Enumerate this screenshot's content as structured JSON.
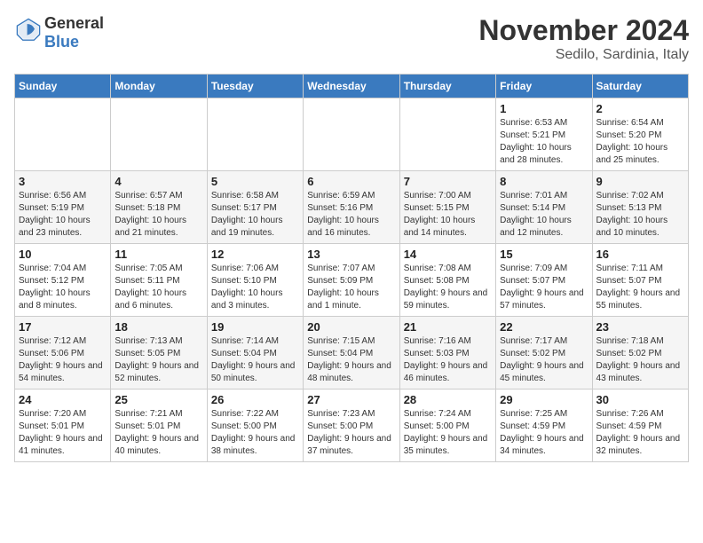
{
  "logo": {
    "line1": "General",
    "line2": "Blue"
  },
  "title": "November 2024",
  "location": "Sedilo, Sardinia, Italy",
  "weekdays": [
    "Sunday",
    "Monday",
    "Tuesday",
    "Wednesday",
    "Thursday",
    "Friday",
    "Saturday"
  ],
  "weeks": [
    [
      {
        "day": "",
        "info": ""
      },
      {
        "day": "",
        "info": ""
      },
      {
        "day": "",
        "info": ""
      },
      {
        "day": "",
        "info": ""
      },
      {
        "day": "",
        "info": ""
      },
      {
        "day": "1",
        "info": "Sunrise: 6:53 AM\nSunset: 5:21 PM\nDaylight: 10 hours and 28 minutes."
      },
      {
        "day": "2",
        "info": "Sunrise: 6:54 AM\nSunset: 5:20 PM\nDaylight: 10 hours and 25 minutes."
      }
    ],
    [
      {
        "day": "3",
        "info": "Sunrise: 6:56 AM\nSunset: 5:19 PM\nDaylight: 10 hours and 23 minutes."
      },
      {
        "day": "4",
        "info": "Sunrise: 6:57 AM\nSunset: 5:18 PM\nDaylight: 10 hours and 21 minutes."
      },
      {
        "day": "5",
        "info": "Sunrise: 6:58 AM\nSunset: 5:17 PM\nDaylight: 10 hours and 19 minutes."
      },
      {
        "day": "6",
        "info": "Sunrise: 6:59 AM\nSunset: 5:16 PM\nDaylight: 10 hours and 16 minutes."
      },
      {
        "day": "7",
        "info": "Sunrise: 7:00 AM\nSunset: 5:15 PM\nDaylight: 10 hours and 14 minutes."
      },
      {
        "day": "8",
        "info": "Sunrise: 7:01 AM\nSunset: 5:14 PM\nDaylight: 10 hours and 12 minutes."
      },
      {
        "day": "9",
        "info": "Sunrise: 7:02 AM\nSunset: 5:13 PM\nDaylight: 10 hours and 10 minutes."
      }
    ],
    [
      {
        "day": "10",
        "info": "Sunrise: 7:04 AM\nSunset: 5:12 PM\nDaylight: 10 hours and 8 minutes."
      },
      {
        "day": "11",
        "info": "Sunrise: 7:05 AM\nSunset: 5:11 PM\nDaylight: 10 hours and 6 minutes."
      },
      {
        "day": "12",
        "info": "Sunrise: 7:06 AM\nSunset: 5:10 PM\nDaylight: 10 hours and 3 minutes."
      },
      {
        "day": "13",
        "info": "Sunrise: 7:07 AM\nSunset: 5:09 PM\nDaylight: 10 hours and 1 minute."
      },
      {
        "day": "14",
        "info": "Sunrise: 7:08 AM\nSunset: 5:08 PM\nDaylight: 9 hours and 59 minutes."
      },
      {
        "day": "15",
        "info": "Sunrise: 7:09 AM\nSunset: 5:07 PM\nDaylight: 9 hours and 57 minutes."
      },
      {
        "day": "16",
        "info": "Sunrise: 7:11 AM\nSunset: 5:07 PM\nDaylight: 9 hours and 55 minutes."
      }
    ],
    [
      {
        "day": "17",
        "info": "Sunrise: 7:12 AM\nSunset: 5:06 PM\nDaylight: 9 hours and 54 minutes."
      },
      {
        "day": "18",
        "info": "Sunrise: 7:13 AM\nSunset: 5:05 PM\nDaylight: 9 hours and 52 minutes."
      },
      {
        "day": "19",
        "info": "Sunrise: 7:14 AM\nSunset: 5:04 PM\nDaylight: 9 hours and 50 minutes."
      },
      {
        "day": "20",
        "info": "Sunrise: 7:15 AM\nSunset: 5:04 PM\nDaylight: 9 hours and 48 minutes."
      },
      {
        "day": "21",
        "info": "Sunrise: 7:16 AM\nSunset: 5:03 PM\nDaylight: 9 hours and 46 minutes."
      },
      {
        "day": "22",
        "info": "Sunrise: 7:17 AM\nSunset: 5:02 PM\nDaylight: 9 hours and 45 minutes."
      },
      {
        "day": "23",
        "info": "Sunrise: 7:18 AM\nSunset: 5:02 PM\nDaylight: 9 hours and 43 minutes."
      }
    ],
    [
      {
        "day": "24",
        "info": "Sunrise: 7:20 AM\nSunset: 5:01 PM\nDaylight: 9 hours and 41 minutes."
      },
      {
        "day": "25",
        "info": "Sunrise: 7:21 AM\nSunset: 5:01 PM\nDaylight: 9 hours and 40 minutes."
      },
      {
        "day": "26",
        "info": "Sunrise: 7:22 AM\nSunset: 5:00 PM\nDaylight: 9 hours and 38 minutes."
      },
      {
        "day": "27",
        "info": "Sunrise: 7:23 AM\nSunset: 5:00 PM\nDaylight: 9 hours and 37 minutes."
      },
      {
        "day": "28",
        "info": "Sunrise: 7:24 AM\nSunset: 5:00 PM\nDaylight: 9 hours and 35 minutes."
      },
      {
        "day": "29",
        "info": "Sunrise: 7:25 AM\nSunset: 4:59 PM\nDaylight: 9 hours and 34 minutes."
      },
      {
        "day": "30",
        "info": "Sunrise: 7:26 AM\nSunset: 4:59 PM\nDaylight: 9 hours and 32 minutes."
      }
    ]
  ]
}
